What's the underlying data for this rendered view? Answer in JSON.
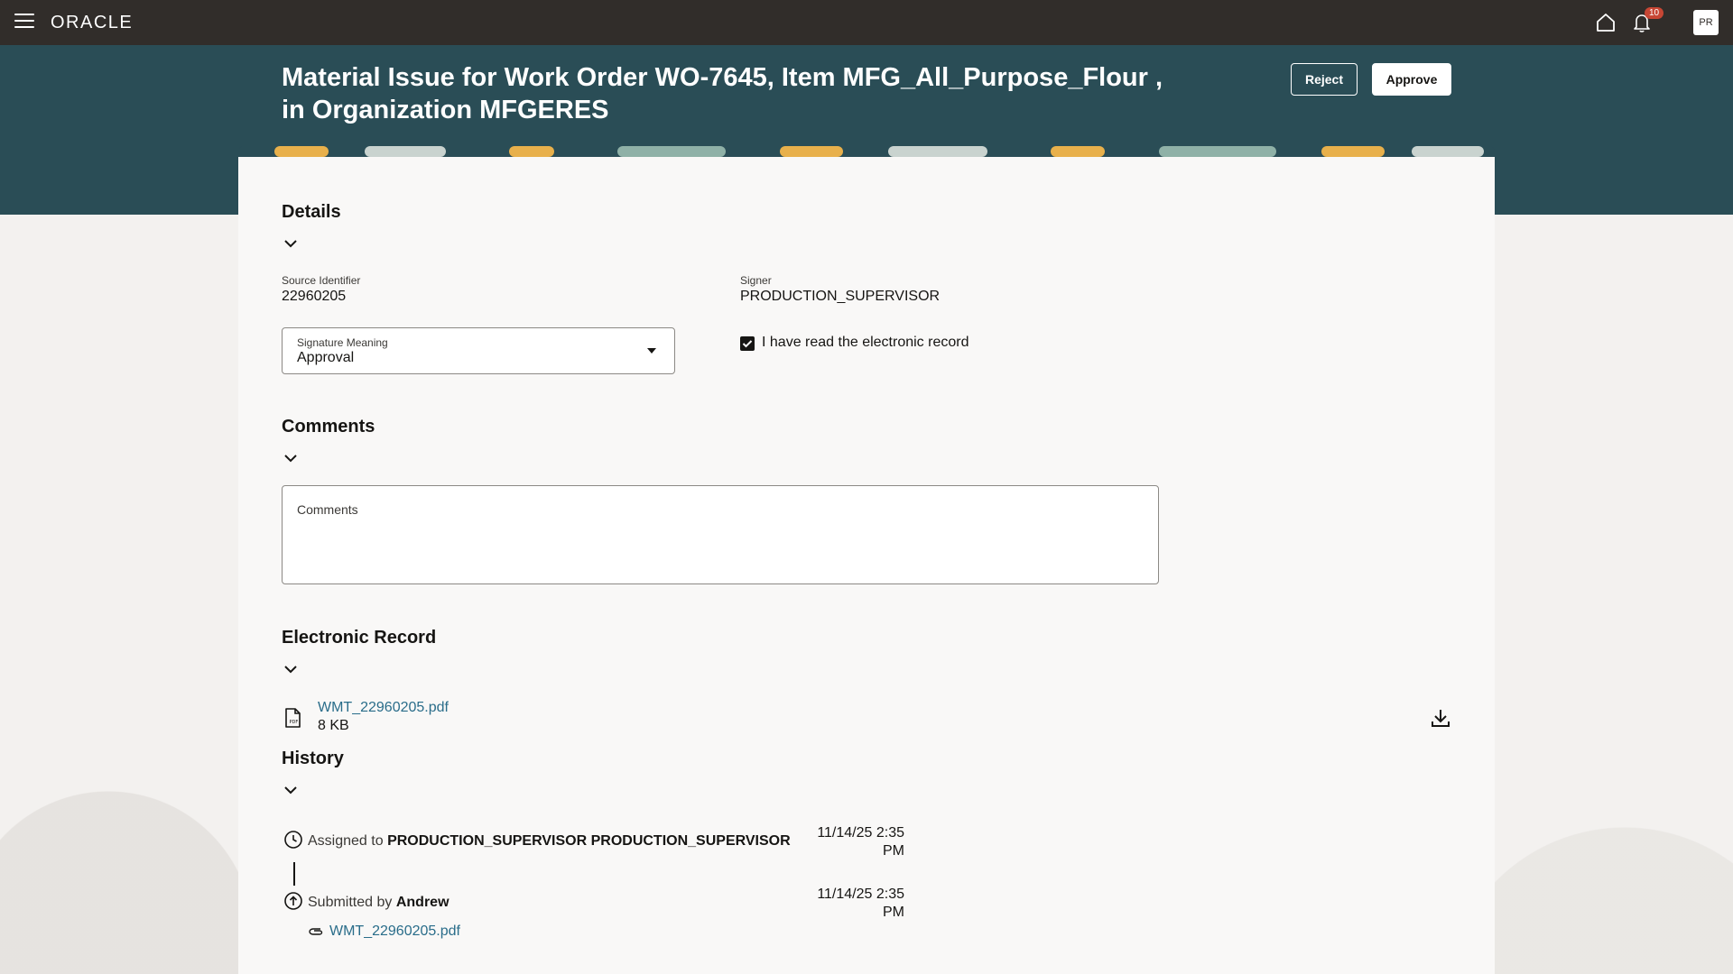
{
  "app": {
    "logo": "ORACLE",
    "notification_count": "10",
    "avatar_initials": "PR"
  },
  "header": {
    "title": "Material Issue for Work Order WO-7645, Item MFG_All_Purpose_Flour , in Organization MFGERES",
    "reject_label": "Reject",
    "approve_label": "Approve"
  },
  "details": {
    "title": "Details",
    "source_identifier_label": "Source Identifier",
    "source_identifier_value": "22960205",
    "signer_label": "Signer",
    "signer_value": "PRODUCTION_SUPERVISOR",
    "signature_meaning_label": "Signature Meaning",
    "signature_meaning_value": "Approval",
    "read_record_label": "I have read the electronic record",
    "read_record_checked": true
  },
  "comments": {
    "title": "Comments",
    "placeholder": "Comments"
  },
  "electronic_record": {
    "title": "Electronic Record",
    "file_name": "WMT_22960205.pdf",
    "file_size": "8 KB"
  },
  "history": {
    "title": "History",
    "entries": [
      {
        "prefix": "Assigned to",
        "actor": "PRODUCTION_SUPERVISOR PRODUCTION_SUPERVISOR",
        "time_line1": "11/14/25 2:35",
        "time_line2": "PM"
      },
      {
        "prefix": "Submitted by",
        "actor": "Andrew",
        "time_line1": "11/14/25 2:35",
        "time_line2": "PM",
        "attachment": "WMT_22960205.pdf"
      }
    ]
  },
  "colors": {
    "topbar": "#312d2a",
    "header_band": "#2a4d56",
    "link": "#2a6d8a",
    "badge": "#c74634"
  }
}
